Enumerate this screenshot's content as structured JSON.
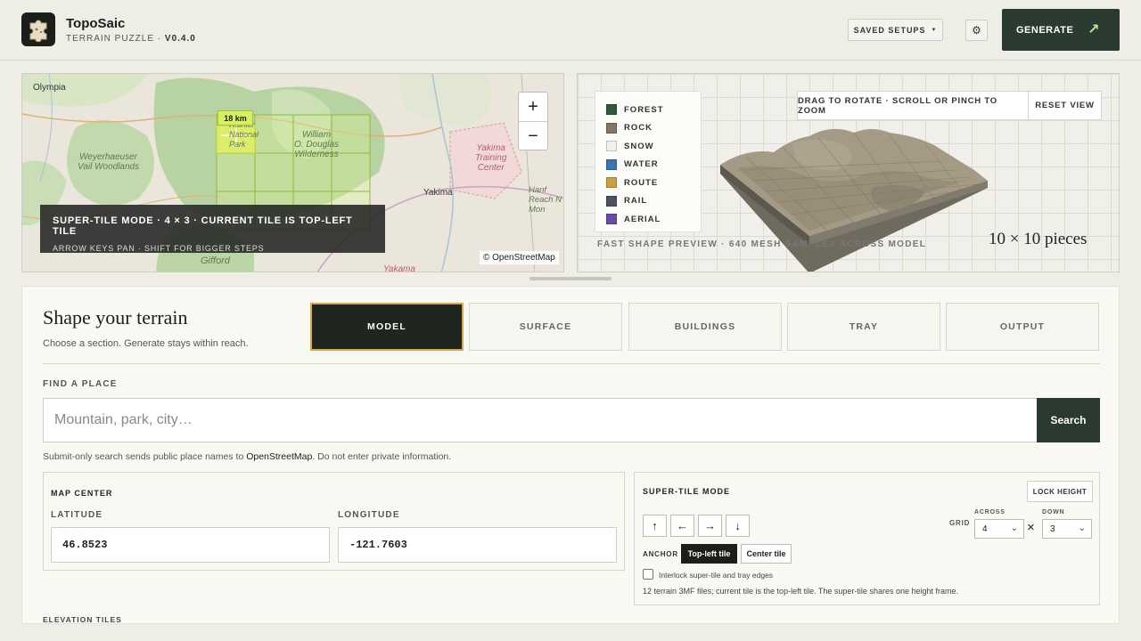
{
  "header": {
    "app_name": "TopoSaic",
    "subtitle_prefix": "TERRAIN PUZZLE · ",
    "version": "V0.4.0",
    "saved_setups": "SAVED SETUPS",
    "settings_icon": "gear-icon",
    "generate": "GENERATE",
    "generate_icon": "arrow-up-right-icon"
  },
  "map": {
    "labels": {
      "olympia": "Olympia",
      "weyerhaeuser": "Weyerhaeuser\nVail Woodlands",
      "yakima_training": "Yakima\nTraining\nCenter",
      "yakima": "Yakima",
      "william_douglas": "William\nO. Douglas\nWilderness",
      "rainier": "Rainier\nNational\nPark",
      "gifford": "Gifford",
      "yakama": "Yakama",
      "hanford": "Hanf\nReach N\nMon"
    },
    "zoom_in": "+",
    "zoom_out": "−",
    "scale_badge": "18 km",
    "overlay_title": "SUPER-TILE MODE · 4 × 3 · CURRENT TILE IS TOP-LEFT TILE",
    "overlay_hint": "ARROW KEYS PAN · SHIFT FOR BIGGER STEPS",
    "attribution": "© OpenStreetMap"
  },
  "preview": {
    "legend": [
      {
        "label": "FOREST",
        "color": "#2f5a3c"
      },
      {
        "label": "ROCK",
        "color": "#857564"
      },
      {
        "label": "SNOW",
        "color": "#f1f1ec"
      },
      {
        "label": "WATER",
        "color": "#3d74b0"
      },
      {
        "label": "ROUTE",
        "color": "#c9a23f"
      },
      {
        "label": "RAIL",
        "color": "#4a5260"
      },
      {
        "label": "AERIAL",
        "color": "#6a4aa6"
      }
    ],
    "drag_hint": "DRAG TO ROTATE · SCROLL OR PINCH TO ZOOM",
    "reset_view": "RESET VIEW",
    "note": "FAST SHAPE PREVIEW · 640 MESH SAMPLES ACROSS MODEL",
    "pieces": "10 × 10 pieces"
  },
  "panel": {
    "title": "Shape your terrain",
    "subtitle": "Choose a section. Generate stays within reach.",
    "tabs": [
      "MODEL",
      "SURFACE",
      "BUILDINGS",
      "TRAY",
      "OUTPUT"
    ],
    "active_tab": "MODEL",
    "find_label": "FIND A PLACE",
    "search_placeholder": "Mountain, park, city…",
    "search_button": "Search",
    "privacy_pre": "Submit-only search sends public place names to ",
    "privacy_link": "OpenStreetMap",
    "privacy_post": ". Do not enter private information.",
    "map_center": {
      "title": "MAP CENTER",
      "lat_label": "LATITUDE",
      "lat_value": "46.8523",
      "lon_label": "LONGITUDE",
      "lon_value": "-121.7603"
    },
    "super_tile": {
      "title": "SUPER-TILE MODE",
      "lock_height": "LOCK HEIGHT",
      "arrows": [
        "↑",
        "←",
        "→",
        "↓"
      ],
      "grid_label": "GRID",
      "across_label": "ACROSS",
      "across_value": "4",
      "down_label": "DOWN",
      "down_value": "3",
      "times": "×",
      "anchor_label": "ANCHOR",
      "anchor_options": [
        "Top-left tile",
        "Center tile"
      ],
      "anchor_selected": "Top-left tile",
      "interlock_label": "Interlock super-tile and tray edges",
      "interlock_checked": false,
      "note": "12 terrain 3MF files; current tile is the top-left tile. The super-tile shares one height frame."
    },
    "elevation_label": "ELEVATION TILES"
  }
}
